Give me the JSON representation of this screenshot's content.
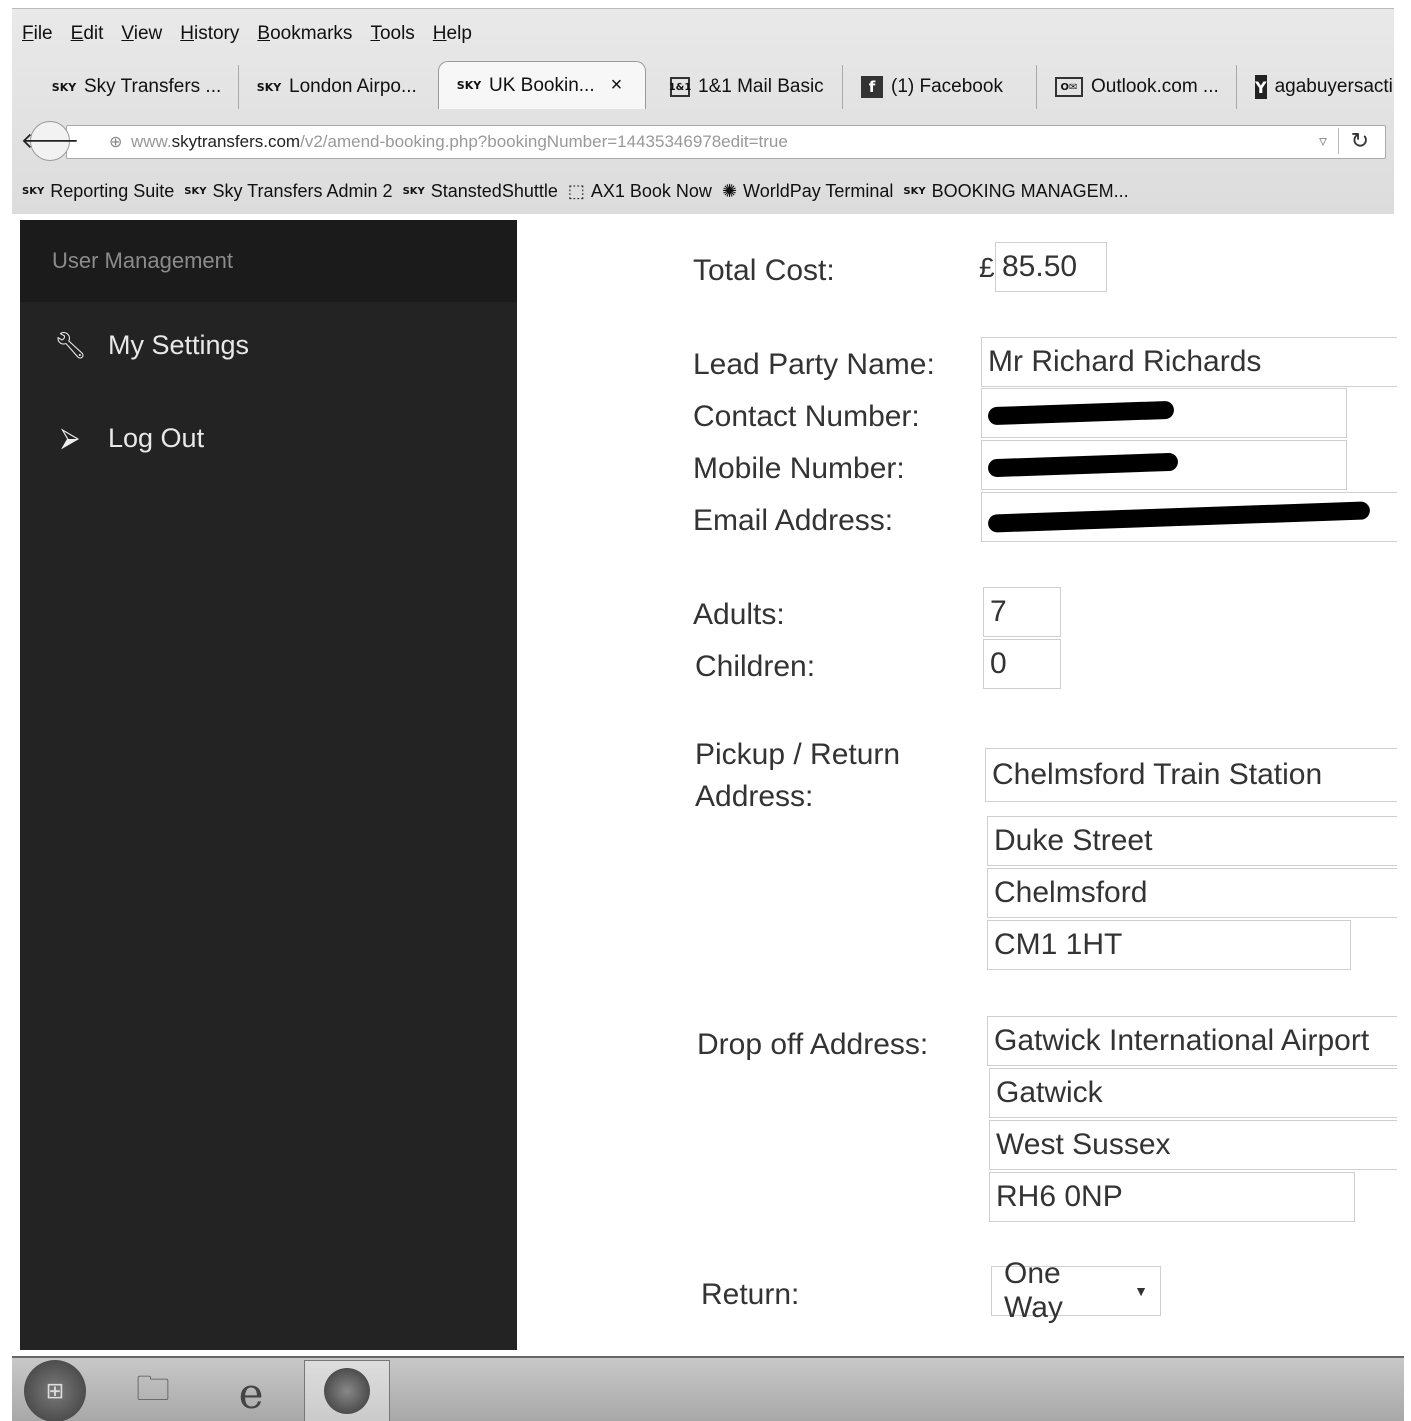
{
  "browser": {
    "menu": [
      "File",
      "Edit",
      "View",
      "History",
      "Bookmarks",
      "Tools",
      "Help"
    ],
    "tabs": [
      {
        "label": "Sky Transfers ...",
        "favicon": "skytransfers-icon"
      },
      {
        "label": "London Airpo...",
        "favicon": "skytransfers-icon"
      },
      {
        "label": "UK Bookin...",
        "favicon": "skytransfers-icon",
        "active": true
      },
      {
        "label": "1&1 Mail Basic",
        "favicon": "mail-icon"
      },
      {
        "label": "(1) Facebook",
        "favicon": "facebook-icon"
      },
      {
        "label": "Outlook.com ...",
        "favicon": "outlook-icon"
      },
      {
        "label": "agabuyersacti",
        "favicon": "yahoo-icon"
      }
    ],
    "url_prefix": "www.",
    "url_domain": "skytransfers.com",
    "url_path": "/v2/amend-booking.php?bookingNumber=14435346978edit=true",
    "bookmarks": [
      "Reporting Suite",
      "Sky Transfers Admin 2",
      "StanstedShuttle",
      "AX1 Book Now",
      "WorldPay Terminal",
      "BOOKING MANAGEM..."
    ]
  },
  "sidebar": {
    "title": "User Management",
    "items": [
      {
        "label": "My Settings",
        "icon": "wrench-icon"
      },
      {
        "label": "Log Out",
        "icon": "logout-icon"
      }
    ]
  },
  "form": {
    "total_cost_label": "Total Cost:",
    "currency": "£",
    "total_cost": "85.50",
    "lead_party_label": "Lead Party Name:",
    "lead_party": "Mr Richard Richards",
    "contact_label": "Contact Number:",
    "mobile_label": "Mobile Number:",
    "email_label": "Email Address:",
    "adults_label": "Adults:",
    "adults": "7",
    "children_label": "Children:",
    "children": "0",
    "pickup_label_1": "Pickup / Return",
    "pickup_label_2": "Address:",
    "pickup_line1": "Chelmsford Train Station",
    "pickup_line2": "Duke Street",
    "pickup_line3": "Chelmsford",
    "pickup_postcode": "CM1 1HT",
    "dropoff_label": "Drop off Address:",
    "dropoff_line1": "Gatwick International Airport",
    "dropoff_line2": "Gatwick",
    "dropoff_line3": "West Sussex",
    "dropoff_postcode": "RH6 0NP",
    "return_label": "Return:",
    "return_value": "One Way"
  }
}
